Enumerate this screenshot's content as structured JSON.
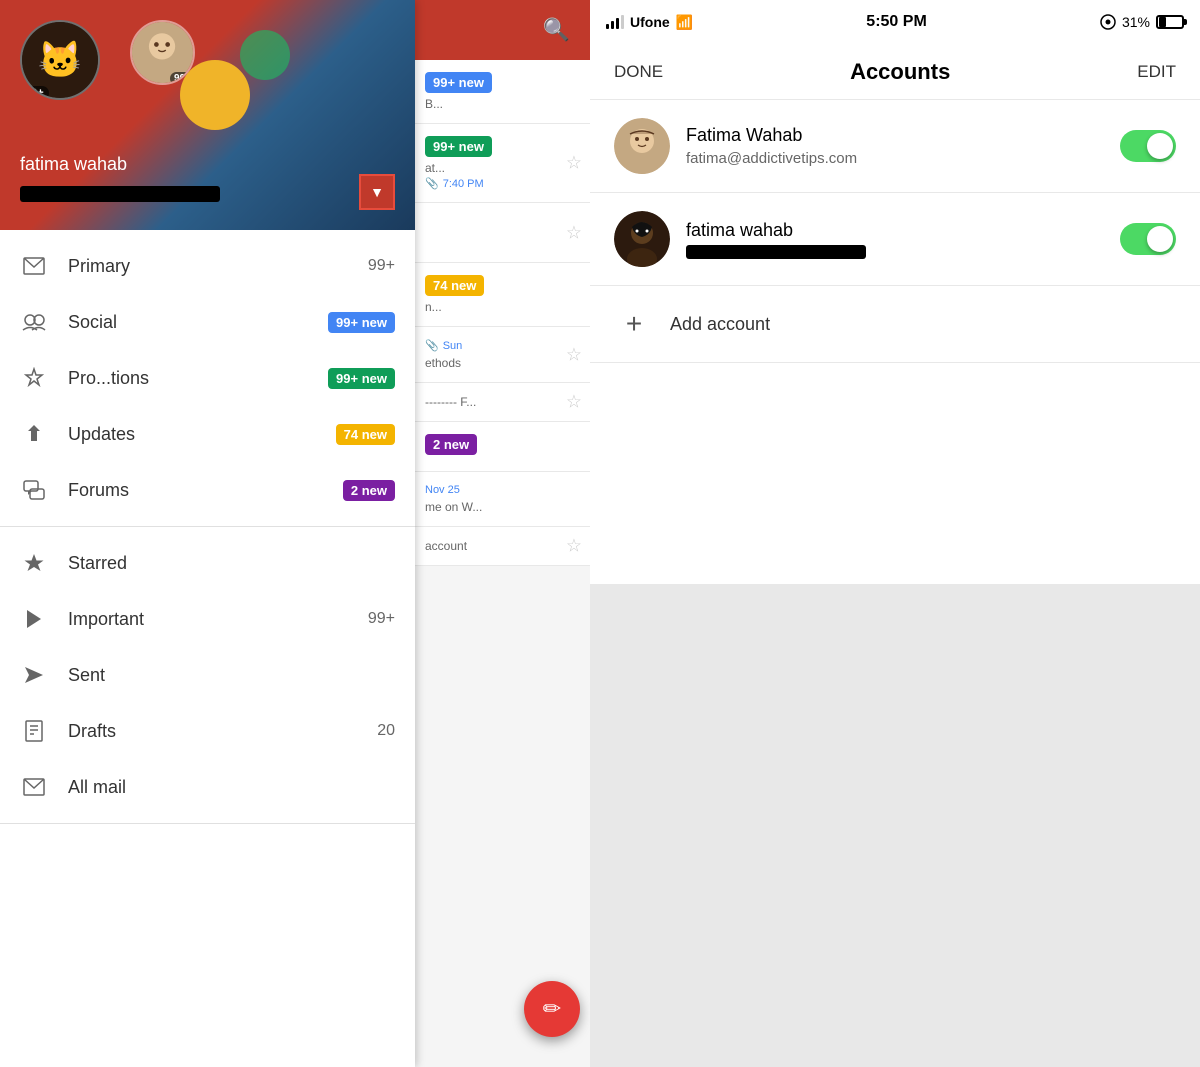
{
  "left": {
    "sidebar": {
      "user": {
        "name": "fatima wahab",
        "badge_main": "99+",
        "badge_secondary": "99+"
      },
      "nav": {
        "primary_label": "Primary",
        "primary_count": "99+",
        "social_label": "Social",
        "social_badge": "99+ new",
        "promotions_label": "Pro...tions",
        "promotions_badge": "99+ new",
        "updates_label": "Updates",
        "updates_badge": "74 new",
        "forums_label": "Forums",
        "forums_badge": "2 new",
        "starred_label": "Starred",
        "important_label": "Important",
        "important_count": "99+",
        "sent_label": "Sent",
        "drafts_label": "Drafts",
        "drafts_count": "20",
        "allmail_label": "All mail"
      }
    },
    "email_list": {
      "items": [
        {
          "badge": "99+ new",
          "badge_color": "blue",
          "preview": "B...",
          "time": ""
        },
        {
          "badge": "99+ new",
          "badge_color": "green",
          "preview": "at...",
          "time": "7:40 PM"
        },
        {
          "badge": "",
          "badge_color": "",
          "preview": "",
          "time": ""
        },
        {
          "badge": "74 new",
          "badge_color": "yellow",
          "preview": "n...",
          "time": ""
        },
        {
          "badge": "",
          "badge_color": "",
          "preview": "ethods",
          "time": "Sun"
        },
        {
          "badge": "",
          "badge_color": "",
          "preview": "-------- F...",
          "time": ""
        },
        {
          "badge": "2 new",
          "badge_color": "purple",
          "preview": "",
          "time": ""
        },
        {
          "badge": "",
          "badge_color": "",
          "preview": "me on W...",
          "time": "Nov 25"
        },
        {
          "badge": "",
          "badge_color": "",
          "preview": "account",
          "time": ""
        }
      ]
    }
  },
  "right": {
    "status_bar": {
      "carrier": "Ufone",
      "time": "5:50 PM",
      "battery": "31%"
    },
    "accounts_header": {
      "done_label": "DONE",
      "title": "Accounts",
      "edit_label": "EDIT"
    },
    "accounts": [
      {
        "name": "Fatima Wahab",
        "email": "fatima@addictivetips.com",
        "email_masked": false,
        "toggle_on": true
      },
      {
        "name": "fatima wahab",
        "email": "",
        "email_masked": true,
        "toggle_on": true
      }
    ],
    "add_account": {
      "label": "Add account"
    }
  }
}
